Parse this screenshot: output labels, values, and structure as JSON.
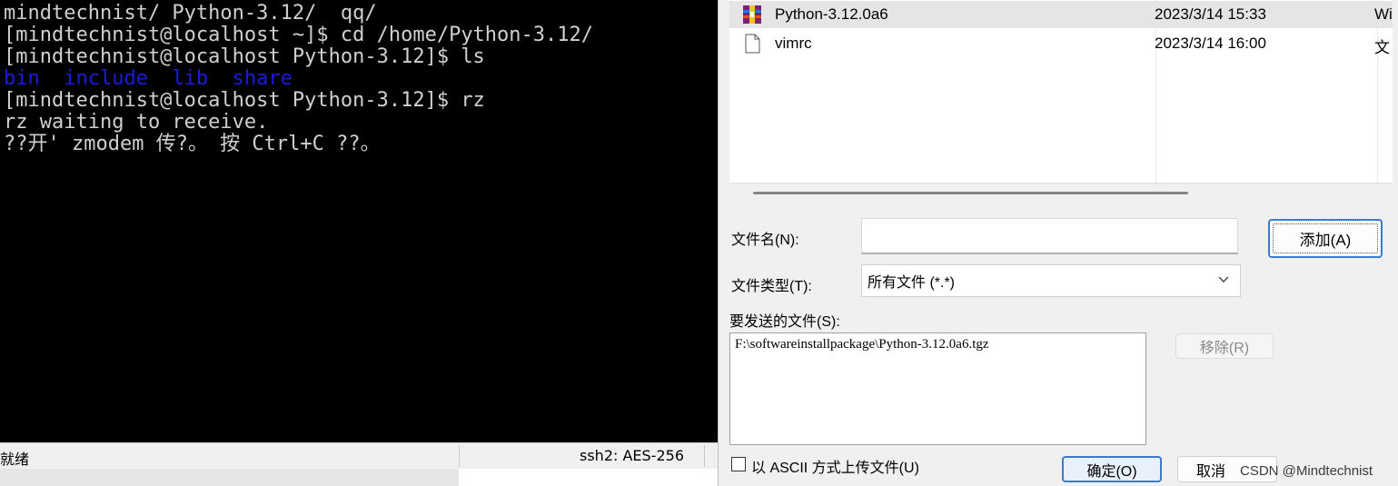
{
  "terminal": {
    "lines": [
      {
        "text": "mindtechnist/ Python-3.12/  qq/"
      },
      {
        "text": "[mindtechnist@localhost ~]$ cd /home/Python-3.12/"
      },
      {
        "text": "[mindtechnist@localhost Python-3.12]$ ls"
      },
      {
        "text": "bin  include  lib  share",
        "color": "#1a1ad8"
      },
      {
        "text": "[mindtechnist@localhost Python-3.12]$ rz"
      },
      {
        "text": "rz waiting to receive."
      },
      {
        "text": "??开' zmodem 传?。 按 Ctrl+C ??。"
      }
    ],
    "status": {
      "left": "就绪",
      "right": "ssh2: AES-256"
    }
  },
  "dialog": {
    "files": [
      {
        "name": "Python-3.12.0a6",
        "date": "2023/3/14 15:33",
        "type": "Wi",
        "icon": "winrar-archive-icon",
        "selected": true
      },
      {
        "name": "vimrc",
        "date": "2023/3/14 16:00",
        "type": "文",
        "icon": "document-icon",
        "selected": false
      }
    ],
    "filename_label": "文件名(N):",
    "filename_value": "",
    "filetype_label": "文件类型(T):",
    "filetype_value": "所有文件 (*.*)",
    "add_label": "添加(A)",
    "send_label": "要发送的文件(S):",
    "send_files": [
      "F:\\softwareinstallpackage\\Python-3.12.0a6.tgz"
    ],
    "remove_label": "移除(R)",
    "ascii_label": "以 ASCII 方式上传文件(U)",
    "ok_label": "确定(O)",
    "cancel_label": "取消",
    "watermark": "CSDN @Mindtechnist"
  }
}
